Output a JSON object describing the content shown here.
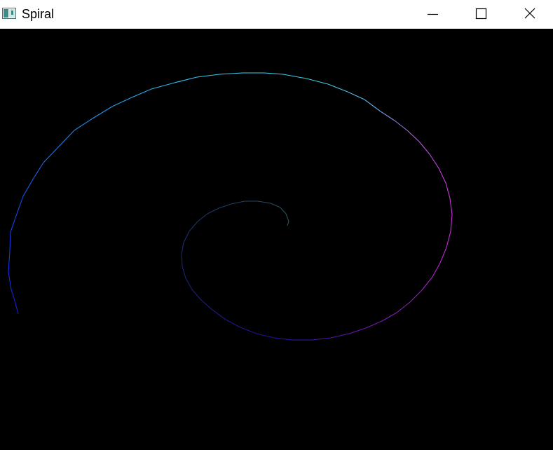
{
  "window": {
    "title": "Spiral",
    "icon": "app-window-icon",
    "controls": {
      "minimize": "minimize-icon",
      "maximize": "maximize-icon",
      "close": "close-icon"
    }
  },
  "canvas": {
    "background": "#000000",
    "spiral_gradient": [
      "#0f3d3b",
      "#1a1aa0",
      "#7a1ab0",
      "#e020e0",
      "#40e0f0",
      "#2080f0",
      "#1020e0"
    ]
  }
}
